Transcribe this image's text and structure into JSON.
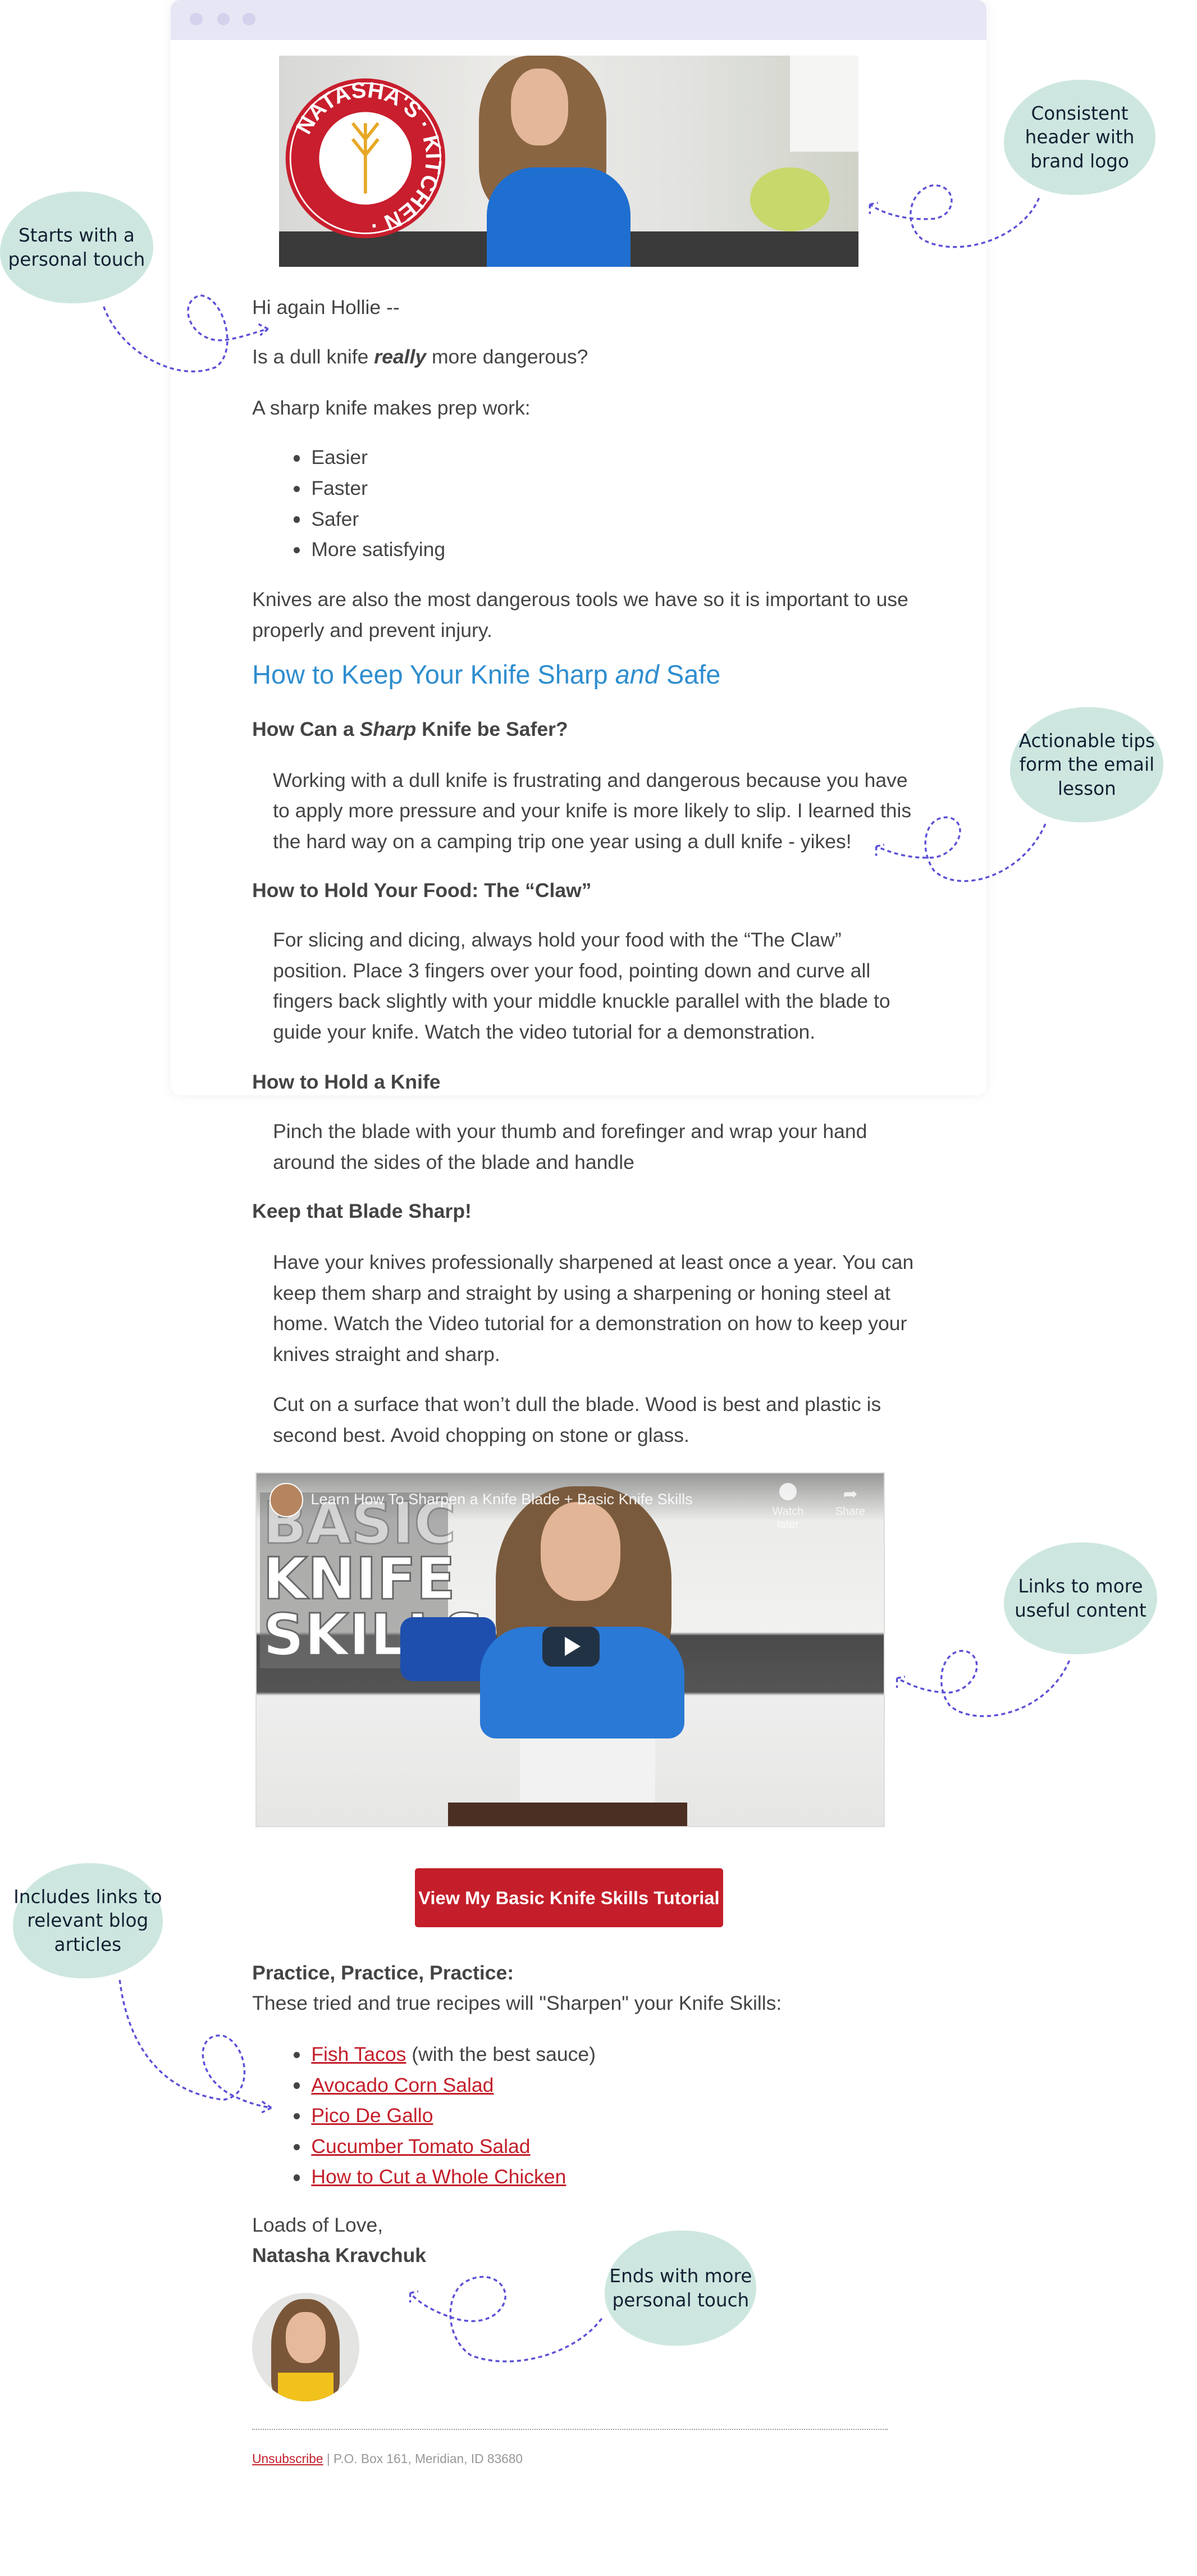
{
  "header_image": {
    "logo_text": "NATASHA'S KITCHEN"
  },
  "email": {
    "greeting": "Hi again Hollie --",
    "question_pre": "Is a dull knife ",
    "question_em": "really",
    "question_post": " more dangerous?",
    "intro": "A sharp knife makes prep work:",
    "benefits": [
      "Easier",
      "Faster",
      "Safer",
      "More satisfying"
    ],
    "knives_para": [
      "Knives are also the most dangerous tools we have so it is important to use",
      "properly and prevent injury."
    ],
    "heading_pre": "How to Keep Your Knife Sharp ",
    "heading_em": "and",
    "heading_post": " Safe",
    "sections": [
      {
        "title_pre": "How Can a ",
        "title_em": "Sharp",
        "title_post": " Knife be Safer?",
        "lines": [
          "Working with a dull knife is frustrating and dangerous because you have",
          "to apply more pressure and your knife is more likely to slip. I learned this",
          "the hard way on a camping trip one year using a dull knife - yikes!"
        ]
      },
      {
        "title": "How to Hold Your Food: The “Claw”",
        "lines": [
          "For slicing and dicing, always hold your food with the “The Claw”",
          "position. Place 3 fingers over your food, pointing down and curve all",
          "fingers back slightly with your middle knuckle parallel with the blade to",
          "guide your knife. Watch the video tutorial for a demonstration."
        ]
      },
      {
        "title": "How to Hold a Knife",
        "lines": [
          "Pinch the blade with your thumb and forefinger and wrap your hand",
          "around the sides of the blade and handle"
        ]
      },
      {
        "title": "Keep that Blade Sharp!",
        "lines": [
          "Have your knives professionally sharpened at least once a year. You can",
          "keep them sharp and straight by using a sharpening or honing steel at",
          "home. Watch the Video tutorial for a demonstration on how to keep your",
          "knives straight and sharp."
        ],
        "lines2": [
          "Cut on a surface that won’t dull the blade. Wood is best and plastic is",
          "second best. Avoid chopping on stone or glass."
        ]
      }
    ],
    "video": {
      "title": "Learn How To Sharpen a Knife Blade + Basic Knife Skills",
      "thumb_text": [
        "BASIC",
        "KNIFE",
        "SKILLS"
      ],
      "watch_later": "Watch later",
      "share": "Share"
    },
    "cta_button": "View My Basic Knife Skills Tutorial",
    "practice_title": "Practice, Practice, Practice:",
    "practice_sub": "These tried and true recipes will \"Sharpen\" your Knife Skills:",
    "recipes": [
      {
        "link": "Fish Tacos",
        "suffix": " (with the best sauce)"
      },
      {
        "link": "Avocado Corn Salad",
        "suffix": ""
      },
      {
        "link": "Pico De Gallo",
        "suffix": ""
      },
      {
        "link": "Cucumber Tomato Salad",
        "suffix": ""
      },
      {
        "link": "How to Cut a Whole Chicken",
        "suffix": ""
      }
    ],
    "signoff": "Loads of Love,",
    "signature": "Natasha Kravchuk",
    "footer": {
      "unsubscribe": "Unsubscribe",
      "address": " | P.O. Box 161, Meridian, ID 83680"
    }
  },
  "annotations": {
    "header": "Consistent header with brand logo",
    "greeting": "Starts with a personal touch",
    "tips": "Actionable tips form the email lesson",
    "video": "Links to more useful content",
    "links": "Includes links to relevant blog articles",
    "signoff": "Ends with more personal touch"
  },
  "colors": {
    "accent_link": "#c41e2a",
    "heading": "#2f8ecf",
    "bubble": "#cde7e0",
    "arrow": "#5b4fd6"
  }
}
